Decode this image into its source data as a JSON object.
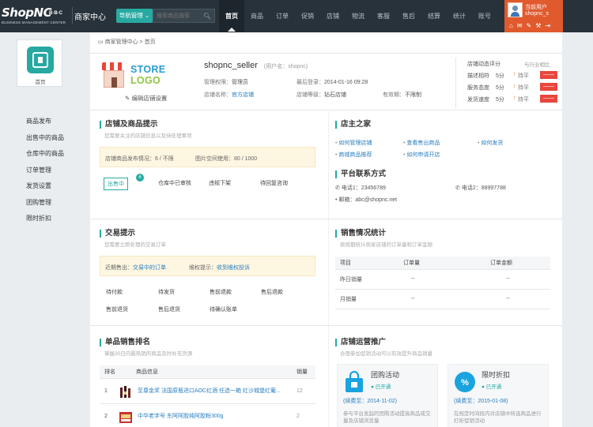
{
  "topbar": {
    "brand": "ShopNC",
    "brand_suffix": "B·B·C",
    "brand_sub": "BUSINESS MANAGEMENT CENTER",
    "title": "商家中心",
    "nav_button": "导航管理",
    "search_placeholder": "搜索商品搜索",
    "nav_items": [
      "首页",
      "商品",
      "订单",
      "促销",
      "店铺",
      "物流",
      "客服",
      "售后",
      "结算",
      "统计",
      "账号"
    ],
    "user_label": "当前用户",
    "user_name": "shopnc_s"
  },
  "sidebar": {
    "home_label": "首页",
    "menu": [
      "商品发布",
      "出售中的商品",
      "仓库中的商品",
      "订单管理",
      "发货设置",
      "团购管理",
      "限时折扣"
    ]
  },
  "breadcrumb": {
    "root": "商家管理中心",
    "sep": ">",
    "current": "首页"
  },
  "store": {
    "logo_text_a": "STORE",
    "logo_text_b": "LOGO",
    "edit_label": "编辑店铺设置",
    "seller": "shopnc_seller",
    "username": "(用户名：shopnc)",
    "perm_label": "管理权限：",
    "perm_value": "管理员",
    "last_login_label": "最后登录：",
    "last_login_value": "2014-01-16 09:28",
    "store_name_label": "店铺名称：",
    "store_name_value": "官方店铺",
    "store_level_label": "店铺等级：",
    "store_level_value": "钻石店铺",
    "valid_label": "有效期：",
    "valid_value": "不限制",
    "rating_title": "店铺动态评分",
    "rating_compare": "与行业相比",
    "ratings": [
      {
        "name": "描述相符",
        "score": "5分",
        "trend": "↑",
        "cmp": "持平",
        "bar": "——"
      },
      {
        "name": "服务态度",
        "score": "5分",
        "trend": "↑",
        "cmp": "持平",
        "bar": "——"
      },
      {
        "name": "发货速度",
        "score": "5分",
        "trend": "↑",
        "cmp": "持平",
        "bar": "——"
      }
    ]
  },
  "store_tips": {
    "title": "店铺及商品提示",
    "subtitle": "您需要关注的店铺信息以及待处理事项",
    "publish_info": "店铺商品发布情况：6 / 不限",
    "space_info": "图片空间使用：80 / 1000",
    "buttons": [
      {
        "label": "出售中",
        "badge": "6"
      },
      {
        "label": "仓库中已审核"
      },
      {
        "label": "违规下架"
      },
      {
        "label": "待回复咨询"
      }
    ]
  },
  "owner": {
    "title": "店主之家",
    "links": [
      "如何管理店铺",
      "查看售出商品",
      "如何发货",
      "商城商品推荐",
      "如何申请开店"
    ]
  },
  "contact": {
    "title": "平台联系方式",
    "phone1": "电话1：23456789",
    "phone2": "电话2：88997788",
    "email": "邮箱：abc@shopnc.net"
  },
  "trade": {
    "title": "交易提示",
    "subtitle": "您需要立即处理的交易订单",
    "recent_label": "近期售出：",
    "recent_link": "交易中的订单",
    "rights_label": "维权提示：",
    "rights_link": "收到维权投诉",
    "grid": [
      [
        "待付款",
        "待发货",
        "售前退款",
        "售后退款"
      ],
      [
        "售前退货",
        "售后退货",
        "待确认账单"
      ]
    ]
  },
  "sales": {
    "title": "销售情况统计",
    "subtitle": "按周期统计商家店铺的订单量和订单金额",
    "headers": [
      "项目",
      "订单量",
      "订单金额"
    ],
    "rows": [
      [
        "昨日销量",
        "--",
        "--"
      ],
      [
        "月销量",
        "--",
        "--"
      ]
    ]
  },
  "ranking": {
    "title": "单品销售排名",
    "subtitle": "掌握30日内最热销的商品及时补充货源",
    "headers": [
      "排名",
      "商品信息",
      "销量"
    ],
    "rows": [
      {
        "rank": "1",
        "name": "至尊金奖 法国原瓶进口AOC红酒 任选一箱 红沙城堡红葡...",
        "sales": "12"
      },
      {
        "rank": "2",
        "name": "中华老字号 东阿阿胶纯阿胶粉300g",
        "sales": "2"
      }
    ]
  },
  "promotion": {
    "title": "店铺运营推广",
    "subtitle": "合理参加促销活动可以有效提升商品销量",
    "items": [
      {
        "name": "团购活动",
        "status": "已开通",
        "expiry": "(续费至：2014-11-02)",
        "desc": "参与平台发起的团购活动提高商品成交量及店铺浏览量"
      },
      {
        "name": "限时折扣",
        "status": "已开通",
        "expiry": "(续费至：2015-01-08)",
        "desc": "在规定时间段内对店铺中所选商品进行打折促销活动"
      }
    ]
  },
  "colors": {
    "accent": "#27a9a1",
    "topbar": "#27323a",
    "user": "#e05a2e",
    "link": "#2a7ec0"
  }
}
